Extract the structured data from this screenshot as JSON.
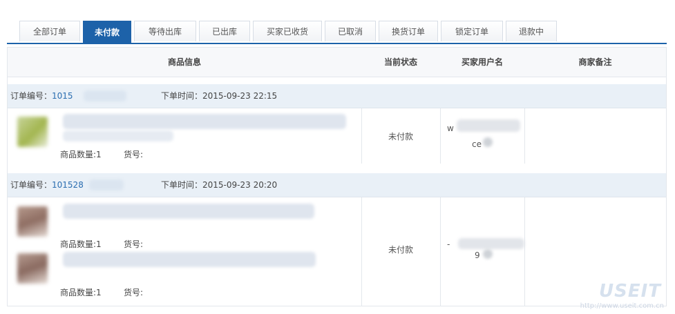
{
  "tabs": [
    {
      "label": "全部订单",
      "active": false
    },
    {
      "label": "未付款",
      "active": true
    },
    {
      "label": "等待出库",
      "active": false
    },
    {
      "label": "已出库",
      "active": false
    },
    {
      "label": "买家已收货",
      "active": false
    },
    {
      "label": "已取消",
      "active": false
    },
    {
      "label": "换货订单",
      "active": false
    },
    {
      "label": "锁定订单",
      "active": false
    },
    {
      "label": "退款中",
      "active": false
    }
  ],
  "table": {
    "headers": {
      "product_info": "商品信息",
      "status": "当前状态",
      "buyer": "买家用户名",
      "merchant_note": "商家备注"
    },
    "orders": [
      {
        "order_label": "订单编号：",
        "order_id": "1015",
        "time_label": "下单时间：",
        "time": "2015-09-23 22:15",
        "items": [
          {
            "qty_label": "商品数量:1",
            "sku_label": "货号:"
          }
        ],
        "status": "未付款",
        "buyer_prefix": "w",
        "buyer_suffix": "ce"
      },
      {
        "order_label": "订单编号：",
        "order_id": "101528",
        "time_label": "下单时间：",
        "time": "2015-09-23 20:20",
        "items": [
          {
            "qty_label": "商品数量:1",
            "sku_label": "货号:"
          },
          {
            "qty_label": "商品数量:1",
            "sku_label": "货号:"
          }
        ],
        "status": "未付款",
        "buyer_prefix": "-",
        "buyer_suffix": "9"
      }
    ]
  },
  "watermark": {
    "brand": "USEIT",
    "url": "http://www.useit.com.cn"
  },
  "colors": {
    "accent": "#1d62a9",
    "order_header_bg": "#e9f0f7",
    "link": "#2a6db0"
  }
}
